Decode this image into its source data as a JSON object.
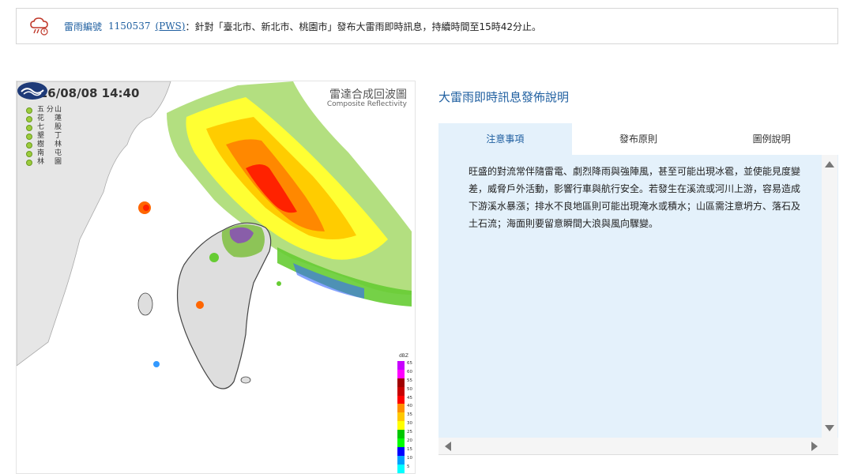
{
  "alert": {
    "icon": "rain-cloud-warning-icon",
    "label": "雷雨編號",
    "number": "1150537",
    "pws": "(PWS)",
    "message": "：針對「臺北市、新北市、桃園市」發布大雷雨即時訊息，持續時間至15時42分止。"
  },
  "radar": {
    "timestamp": "2026/08/08 14:40",
    "title_cn": "雷達合成回波圖",
    "title_en": "Composite Reflectivity",
    "stations": [
      {
        "a": "五 分",
        "b": "山"
      },
      {
        "a": "花",
        "b": "蓮"
      },
      {
        "a": "七",
        "b": "股"
      },
      {
        "a": "墾",
        "b": "丁"
      },
      {
        "a": "樹",
        "b": "林"
      },
      {
        "a": "南",
        "b": "屯"
      },
      {
        "a": "林",
        "b": "園"
      }
    ],
    "legend_unit": "dBZ",
    "legend_levels": [
      "65",
      "60",
      "55",
      "50",
      "45",
      "40",
      "35",
      "30",
      "25",
      "20",
      "15",
      "10",
      "5"
    ],
    "legend_colors": [
      "#c800ff",
      "#ff00ff",
      "#a00000",
      "#c80000",
      "#ff0000",
      "#ff9000",
      "#ffc800",
      "#ffff00",
      "#00c800",
      "#00ff00",
      "#0000ff",
      "#00a0ff",
      "#00ffff"
    ],
    "logo": "cwa-logo-icon"
  },
  "info": {
    "heading": "大雷雨即時訊息發佈說明",
    "tabs": [
      {
        "label": "注意事項",
        "active": true
      },
      {
        "label": "發布原則",
        "active": false
      },
      {
        "label": "圖例說明",
        "active": false
      }
    ],
    "content": "旺盛的對流常伴隨雷電、劇烈降雨與強陣風，甚至可能出現冰雹，並使能見度變差，威脅戶外活動，影響行車與航行安全。若發生在溪流或河川上游，容易造成下游溪水暴漲；排水不良地區則可能出現淹水或積水；山區需注意坍方、落石及土石流；海面則要留意瞬間大浪與風向驟變。"
  }
}
